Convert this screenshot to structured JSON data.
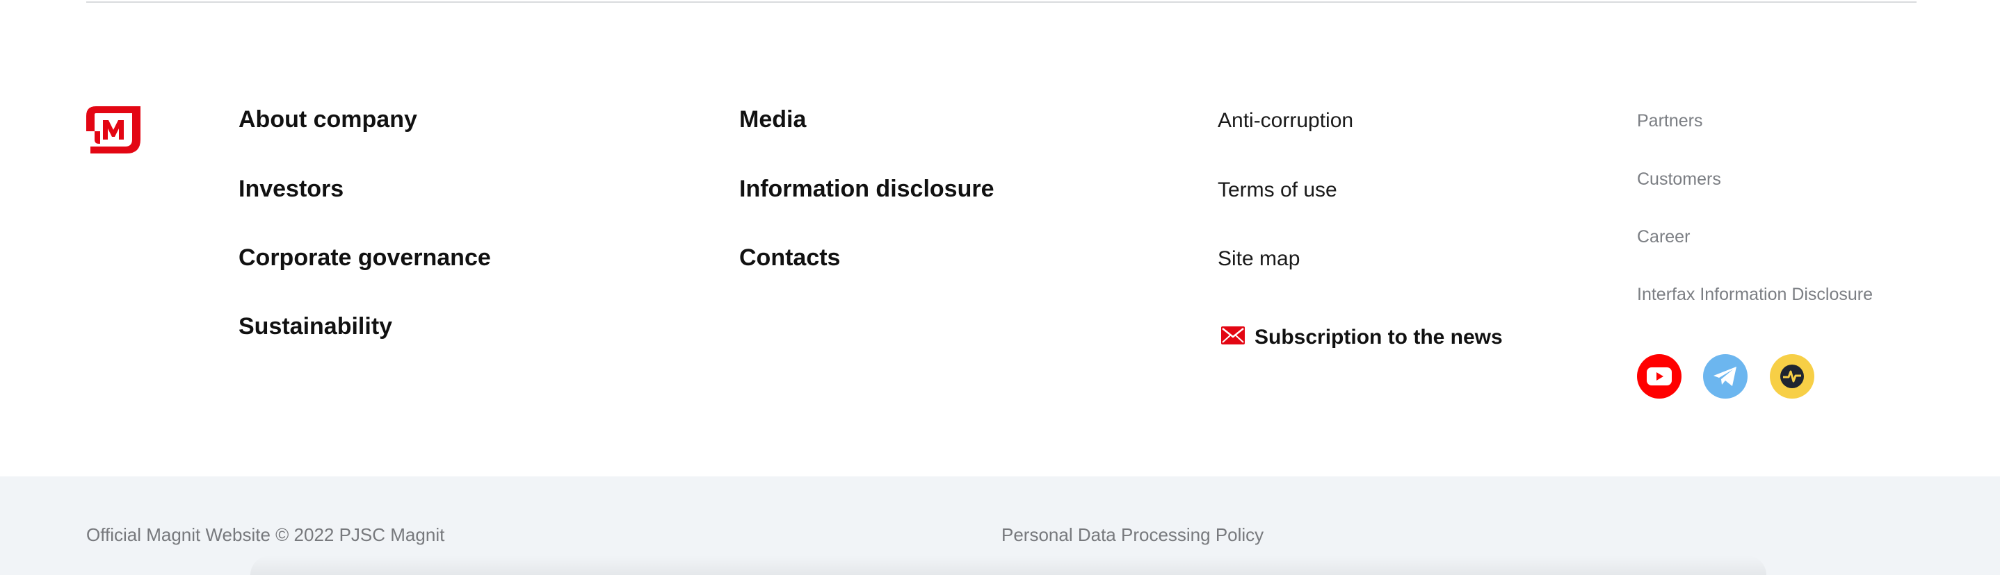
{
  "colors": {
    "brand_red": "#e30613",
    "youtube": "#ff0000",
    "telegram": "#6cb6ef",
    "pulse": "#f7cf46",
    "muted_text": "#7b7e83",
    "bottom_bg": "#f1f4f7"
  },
  "logo": {
    "icon": "magnit-logo-icon"
  },
  "nav_primary": [
    {
      "label": "About company"
    },
    {
      "label": "Investors"
    },
    {
      "label": "Corporate governance"
    },
    {
      "label": "Sustainability"
    }
  ],
  "nav_secondary": [
    {
      "label": "Media"
    },
    {
      "label": "Information disclosure"
    },
    {
      "label": "Contacts"
    }
  ],
  "nav_tertiary": [
    {
      "label": "Anti-corruption"
    },
    {
      "label": "Terms of use"
    },
    {
      "label": "Site map"
    }
  ],
  "subscribe": {
    "label": "Subscription to the news",
    "icon": "envelope-icon"
  },
  "nav_small": [
    {
      "label": "Partners"
    },
    {
      "label": "Customers"
    },
    {
      "label": "Career"
    },
    {
      "label": "Interfax Information Disclosure"
    }
  ],
  "social": [
    {
      "icon": "youtube-icon"
    },
    {
      "icon": "telegram-icon"
    },
    {
      "icon": "pulse-icon"
    }
  ],
  "bottom": {
    "copyright": "Official Magnit Website © 2022 PJSC Magnit",
    "policy": "Personal Data Processing Policy"
  }
}
